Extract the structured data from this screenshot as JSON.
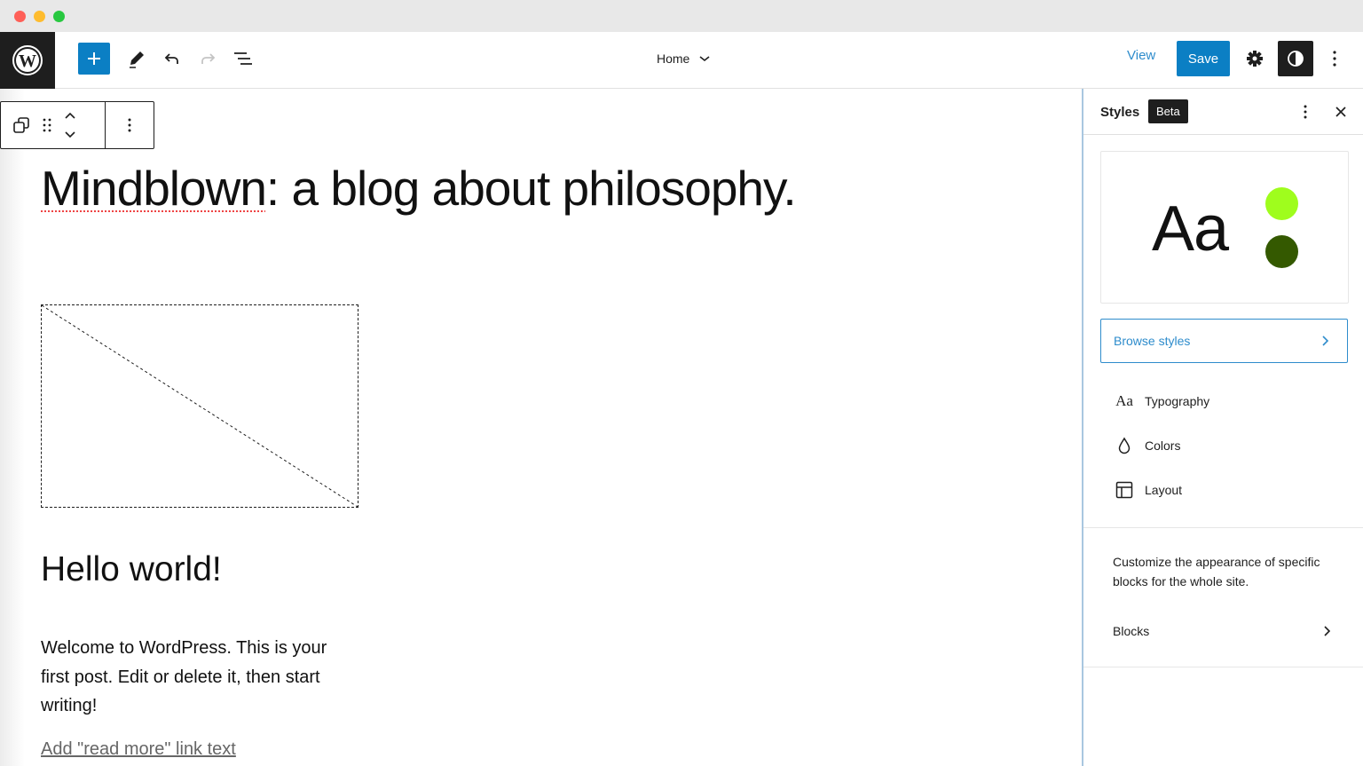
{
  "window": {
    "controls": [
      "close",
      "minimize",
      "maximize"
    ]
  },
  "header": {
    "logo_icon": "wordpress-logo-icon",
    "toolbar_icons": [
      "plus-icon",
      "pencil-icon",
      "undo-icon",
      "redo-icon",
      "list-view-icon"
    ],
    "document_title": "Home",
    "view_label": "View",
    "save_label": "Save",
    "right_icons": [
      "gear-icon",
      "half-circle-contrast-icon",
      "vertical-ellipsis-icon"
    ],
    "colors": {
      "accent": "#0b7fc4",
      "dark": "#1e1e1e",
      "link": "#2e8ccc"
    }
  },
  "block_toolbar": {
    "icons": [
      "duplicate-icon",
      "drag-handle-icon",
      "move-up-down-icon",
      "vertical-ellipsis-icon"
    ]
  },
  "canvas": {
    "site_title_misspelled": "Mindblown",
    "site_title_rest": ": a blog about philosophy.",
    "post_title": "Hello world!",
    "post_excerpt": "Welcome to WordPress. This is your first post. Edit or delete it, then start writing!",
    "read_more": "Add \"read more\" link text"
  },
  "sidebar": {
    "title": "Styles",
    "badge": "Beta",
    "preview": {
      "sample_text": "Aa",
      "swatches": [
        "#9ffd1d",
        "#345900"
      ]
    },
    "browse_styles": "Browse styles",
    "items": [
      {
        "label": "Typography",
        "icon": "typography-icon"
      },
      {
        "label": "Colors",
        "icon": "droplet-icon"
      },
      {
        "label": "Layout",
        "icon": "layout-icon"
      }
    ],
    "blocks_description": "Customize the appearance of specific blocks for the whole site.",
    "blocks_label": "Blocks"
  }
}
